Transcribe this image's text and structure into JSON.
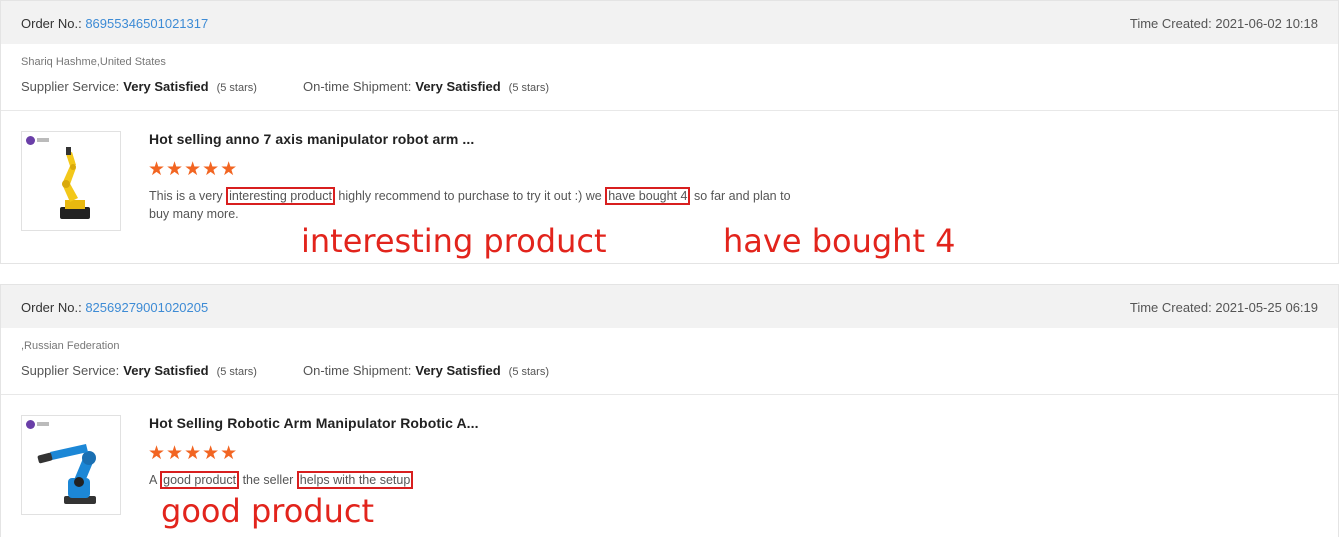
{
  "orders": [
    {
      "order_no_label": "Order No.:",
      "order_no": "86955346501021317",
      "time_created": "Time Created: 2021-06-02 10:18",
      "buyer": "Shariq Hashme,United States",
      "supplier_service_label": "Supplier Service:",
      "supplier_service_value": "Very Satisfied",
      "supplier_service_stars": "(5 stars)",
      "shipment_label": "On-time Shipment:",
      "shipment_value": "Very Satisfied",
      "shipment_stars": "(5 stars)",
      "product_title": "Hot selling anno 7 axis manipulator robot arm ...",
      "rating_stars": "★★★★★",
      "review_parts": {
        "a": "This is a very ",
        "h1": "interesting product",
        "b": " highly recommend to purchase to try it out :) we ",
        "h2": "have bought 4",
        "c": " so far and plan to buy many more."
      },
      "annotations": [
        "interesting product",
        "have bought 4"
      ]
    },
    {
      "order_no_label": "Order No.:",
      "order_no": "82569279001020205",
      "time_created": "Time Created: 2021-05-25 06:19",
      "buyer": ",Russian Federation",
      "supplier_service_label": "Supplier Service:",
      "supplier_service_value": "Very Satisfied",
      "supplier_service_stars": "(5 stars)",
      "shipment_label": "On-time Shipment:",
      "shipment_value": "Very Satisfied",
      "shipment_stars": "(5 stars)",
      "product_title": "Hot Selling Robotic Arm Manipulator Robotic A...",
      "rating_stars": "★★★★★",
      "review_parts": {
        "a": "A ",
        "h1": "good product",
        "b": " the seller ",
        "h2": "helps with the setup",
        "c": ""
      },
      "annotations": [
        "good product"
      ]
    }
  ],
  "colors": {
    "link": "#3d8bd5",
    "star": "#f26522",
    "highlight": "#d81f1f",
    "robot_yellow": "#f3c81a",
    "robot_blue": "#1c87d6"
  }
}
